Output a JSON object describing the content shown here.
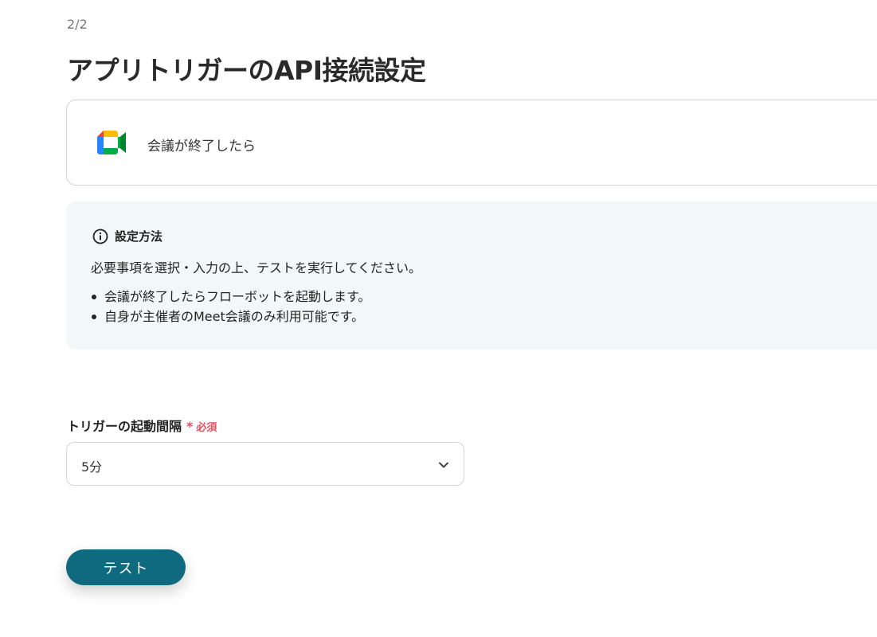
{
  "header": {
    "step": "2/2",
    "title": "アプリトリガーのAPI接続設定"
  },
  "trigger": {
    "app_icon": "google-meet-icon",
    "label": "会議が終了したら"
  },
  "info": {
    "icon": "info-circle-icon",
    "title": "設定方法",
    "description": "必要事項を選択・入力の上、テストを実行してください。",
    "bullets": [
      "会議が終了したらフローボットを起動します。",
      "自身が主催者のMeet会議のみ利用可能です。"
    ]
  },
  "form": {
    "interval_label": "トリガーの起動間隔",
    "required_mark": "*",
    "required_text": "必須",
    "interval_value": "5分"
  },
  "actions": {
    "test_label": "テスト"
  },
  "colors": {
    "primary_button": "#0f6a80",
    "info_background": "#f1f8f7",
    "required": "#e05260",
    "border": "#d4d4d4"
  }
}
